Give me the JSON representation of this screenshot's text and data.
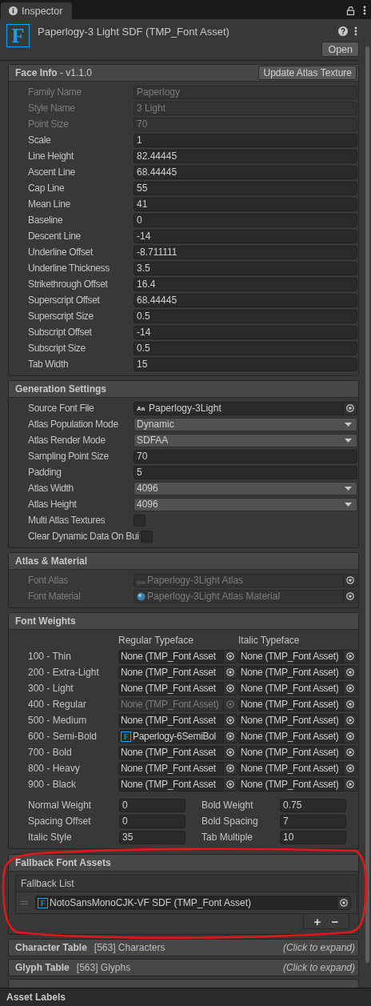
{
  "tab": {
    "label": "Inspector"
  },
  "asset": {
    "icon": "F",
    "title": "Paperlogy-3 Light SDF (TMP_Font Asset)",
    "open_button": "Open"
  },
  "face_info": {
    "title": "Face Info",
    "version": "- v1.1.0",
    "button": "Update Atlas Texture",
    "fields": [
      {
        "label": "Family Name",
        "value": "Paperlogy",
        "kind": "text",
        "disabled": true
      },
      {
        "label": "Style Name",
        "value": "3 Light",
        "kind": "text",
        "disabled": true
      },
      {
        "label": "Point Size",
        "value": "70",
        "kind": "text",
        "disabled": true
      },
      {
        "label": "Scale",
        "value": "1",
        "kind": "text",
        "disabled": false
      },
      {
        "label": "Line Height",
        "value": "82.44445",
        "kind": "text",
        "disabled": false
      },
      {
        "label": "Ascent Line",
        "value": "68.44445",
        "kind": "text",
        "disabled": false
      },
      {
        "label": "Cap Line",
        "value": "55",
        "kind": "text",
        "disabled": false
      },
      {
        "label": "Mean Line",
        "value": "41",
        "kind": "text",
        "disabled": false
      },
      {
        "label": "Baseline",
        "value": "0",
        "kind": "text",
        "disabled": false
      },
      {
        "label": "Descent Line",
        "value": "-14",
        "kind": "text",
        "disabled": false
      },
      {
        "label": "Underline Offset",
        "value": "-8.711111",
        "kind": "text",
        "disabled": false
      },
      {
        "label": "Underline Thickness",
        "value": "3.5",
        "kind": "text",
        "disabled": false
      },
      {
        "label": "Strikethrough Offset",
        "value": "16.4",
        "kind": "text",
        "disabled": false
      },
      {
        "label": "Superscript Offset",
        "value": "68.44445",
        "kind": "text",
        "disabled": false
      },
      {
        "label": "Superscript Size",
        "value": "0.5",
        "kind": "text",
        "disabled": false
      },
      {
        "label": "Subscript Offset",
        "value": "-14",
        "kind": "text",
        "disabled": false
      },
      {
        "label": "Subscript Size",
        "value": "0.5",
        "kind": "text",
        "disabled": false
      },
      {
        "label": "Tab Width",
        "value": "15",
        "kind": "text",
        "disabled": false
      }
    ]
  },
  "generation_settings": {
    "title": "Generation Settings",
    "fields": [
      {
        "label": "Source Font File",
        "value": "Paperlogy-3Light",
        "icon": "Aa",
        "kind": "object",
        "disabled": false
      },
      {
        "label": "Atlas Population Mode",
        "value": "Dynamic",
        "kind": "dropdown",
        "disabled": false
      },
      {
        "label": "Atlas Render Mode",
        "value": "SDFAA",
        "kind": "dropdown",
        "disabled": false
      },
      {
        "label": "Sampling Point Size",
        "value": "70",
        "kind": "text",
        "disabled": false
      },
      {
        "label": "Padding",
        "value": "5",
        "kind": "text",
        "disabled": false
      },
      {
        "label": "Atlas Width",
        "value": "4096",
        "kind": "dropdown",
        "disabled": false
      },
      {
        "label": "Atlas Height",
        "value": "4096",
        "kind": "dropdown",
        "disabled": false
      },
      {
        "label": "Multi Atlas Textures",
        "kind": "checkbox",
        "checked": false,
        "disabled": false
      },
      {
        "label": "Clear Dynamic Data On Bui",
        "kind": "checkbox",
        "checked": false,
        "disabled": false
      }
    ]
  },
  "atlas_material": {
    "title": "Atlas & Material",
    "fields": [
      {
        "label": "Font Atlas",
        "value": "Paperlogy-3Light Atlas",
        "kind": "texture",
        "disabled": true
      },
      {
        "label": "Font Material",
        "value": "Paperlogy-3Light Atlas Material",
        "kind": "material",
        "disabled": true
      }
    ]
  },
  "font_weights": {
    "title": "Font Weights",
    "columns": [
      "Regular Typeface",
      "Italic Typeface"
    ],
    "rows": [
      {
        "label": "100 - Thin",
        "regular": {
          "value": "None (TMP_Font Asset",
          "disabled": false
        },
        "italic": {
          "value": "None (TMP_Font Asset)",
          "disabled": false
        }
      },
      {
        "label": "200 - Extra-Light",
        "regular": {
          "value": "None (TMP_Font Asset",
          "disabled": false
        },
        "italic": {
          "value": "None (TMP_Font Asset)",
          "disabled": false
        }
      },
      {
        "label": "300 - Light",
        "regular": {
          "value": "None (TMP_Font Asset",
          "disabled": false
        },
        "italic": {
          "value": "None (TMP_Font Asset)",
          "disabled": false
        }
      },
      {
        "label": "400 - Regular",
        "regular": {
          "value": "None (TMP_Font Asset)",
          "disabled": true
        },
        "italic": {
          "value": "None (TMP_Font Asset)",
          "disabled": false
        }
      },
      {
        "label": "500 - Medium",
        "regular": {
          "value": "None (TMP_Font Asset",
          "disabled": false
        },
        "italic": {
          "value": "None (TMP_Font Asset)",
          "disabled": false
        }
      },
      {
        "label": "600 - Semi-Bold",
        "regular": {
          "icon": "F",
          "value": "Paperlogy-6SemiBol",
          "disabled": false
        },
        "italic": {
          "value": "None (TMP_Font Asset)",
          "disabled": false
        }
      },
      {
        "label": "700 - Bold",
        "regular": {
          "value": "None (TMP_Font Asset",
          "disabled": false
        },
        "italic": {
          "value": "None (TMP_Font Asset)",
          "disabled": false
        }
      },
      {
        "label": "800 - Heavy",
        "regular": {
          "value": "None (TMP_Font Asset",
          "disabled": false
        },
        "italic": {
          "value": "None (TMP_Font Asset)",
          "disabled": false
        }
      },
      {
        "label": "900 - Black",
        "regular": {
          "value": "None (TMP_Font Asset",
          "disabled": false
        },
        "italic": {
          "value": "None (TMP_Font Asset)",
          "disabled": false
        }
      }
    ],
    "settings": [
      {
        "label": "Normal Weight",
        "value": "0",
        "label_2": "Bold Weight",
        "value_2": "0.75"
      },
      {
        "label": "Spacing Offset",
        "value": "0",
        "label_2": "Bold Spacing",
        "value_2": "7"
      },
      {
        "label": "Italic Style",
        "value": "35",
        "label_2": "Tab Multiple",
        "value_2": "10"
      }
    ]
  },
  "fallback_font_assets": {
    "title": "Fallback Font Assets",
    "list_label": "Fallback List",
    "items": [
      {
        "icon": "F",
        "name": "NotoSansMonoCJK-VF SDF (TMP_Font Asset)"
      }
    ],
    "add_button": "+",
    "remove_button": "−"
  },
  "collapsed_sections": [
    {
      "title": "Character Table",
      "count": "[563] Characters",
      "hint": "(Click to expand)"
    },
    {
      "title": "Glyph Table",
      "count": "[563] Glyphs",
      "hint": "(Click to expand)"
    }
  ],
  "footer": {
    "title": "Asset Labels"
  }
}
